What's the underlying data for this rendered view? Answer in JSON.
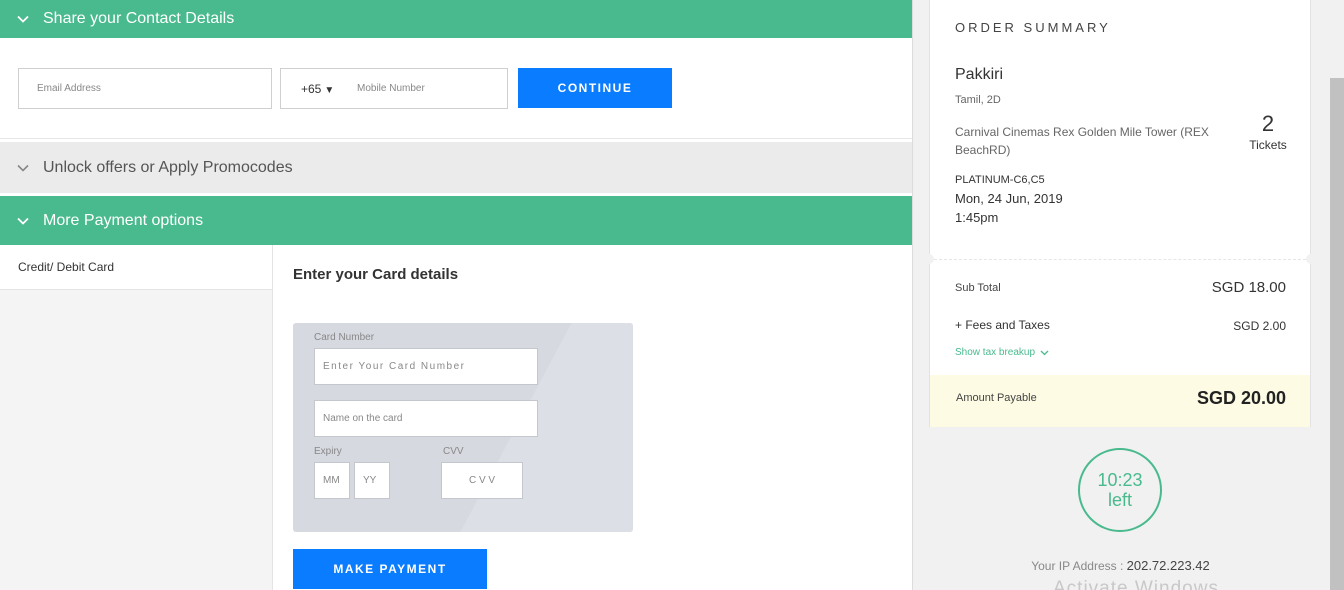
{
  "contact": {
    "title": "Share your Contact Details",
    "email_placeholder": "Email Address",
    "country_code": "+65",
    "mobile_placeholder": "Mobile Number",
    "continue_label": "CONTINUE"
  },
  "promo": {
    "title": "Unlock offers or Apply Promocodes"
  },
  "payment": {
    "title": "More Payment options",
    "methods": [
      "Credit/ Debit Card"
    ],
    "card_section_title": "Enter your Card details",
    "card_number_label": "Card Number",
    "card_number_placeholder": "Enter Your Card Number",
    "name_placeholder": "Name on the card",
    "expiry_label": "Expiry",
    "mm_placeholder": "MM",
    "yy_placeholder": "YY",
    "cvv_label": "CVV",
    "cvv_placeholder": "C V V",
    "make_payment_label": "MAKE PAYMENT"
  },
  "summary": {
    "title": "ORDER SUMMARY",
    "movie": "Pakkiri",
    "language_format": "Tamil, 2D",
    "venue": "Carnival Cinemas Rex Golden Mile Tower (REX BeachRD)",
    "ticket_count": "2",
    "ticket_label": "Tickets",
    "seats": "PLATINUM-C6,C5",
    "date": "Mon, 24 Jun, 2019",
    "time": "1:45pm",
    "subtotal_label": "Sub Total",
    "subtotal_value": "SGD 18.00",
    "fees_label": "+ Fees and Taxes",
    "fees_value": "SGD 2.00",
    "tax_breakup_label": "Show tax breakup",
    "payable_label": "Amount Payable",
    "payable_value": "SGD 20.00"
  },
  "timer": {
    "time": "10:23",
    "suffix": "left"
  },
  "ip": {
    "label": "Your IP Address : ",
    "value": "202.72.223.42"
  },
  "watermark": "Activate Windows",
  "colors": {
    "green": "#49ba8e",
    "blue": "#0a7cff",
    "payable_bg": "#fdfbe4"
  }
}
